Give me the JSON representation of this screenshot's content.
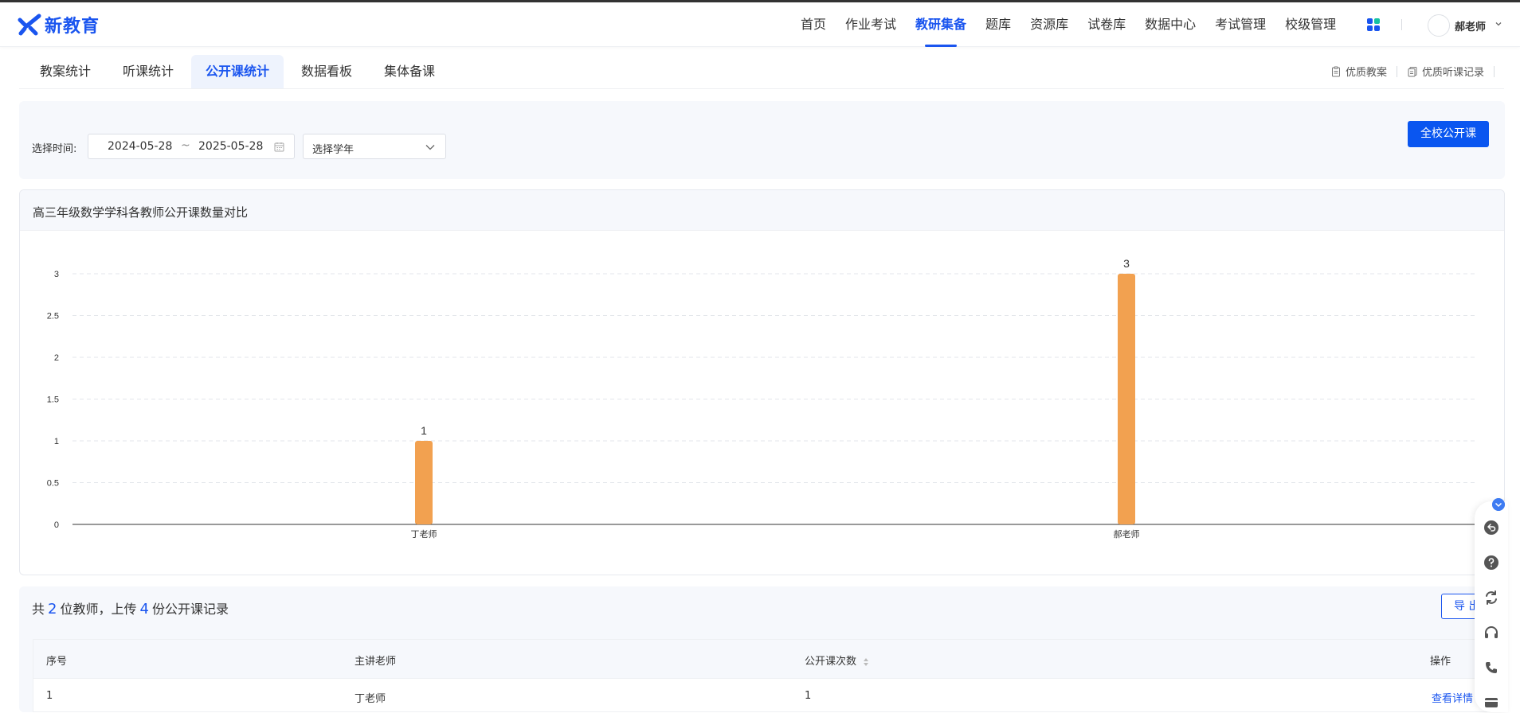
{
  "app": {
    "logo_text": "新教育",
    "brand_color": "#1a55ef"
  },
  "nav": {
    "items": [
      {
        "label": "首页"
      },
      {
        "label": "作业考试"
      },
      {
        "label": "教研集备",
        "active": true
      },
      {
        "label": "题库"
      },
      {
        "label": "资源库"
      },
      {
        "label": "试卷库"
      },
      {
        "label": "数据中心"
      },
      {
        "label": "考试管理"
      },
      {
        "label": "校级管理"
      }
    ],
    "apps_icon": "apps-grid-icon",
    "user": {
      "name": "郝老师"
    }
  },
  "subnav": {
    "tabs": [
      {
        "label": "教案统计"
      },
      {
        "label": "听课统计"
      },
      {
        "label": "公开课统计",
        "active": true
      },
      {
        "label": "数据看板"
      },
      {
        "label": "集体备课"
      }
    ],
    "quick_links": [
      {
        "label": "优质教案",
        "icon": "clipboard-icon"
      },
      {
        "label": "优质听课记录",
        "icon": "notes-icon"
      }
    ]
  },
  "filters": {
    "time_label": "选择时间:",
    "start_date": "2024-05-28",
    "range_sep": "~",
    "end_date": "2025-05-28",
    "year_placeholder": "选择学年",
    "school_button": "全校公开课"
  },
  "chart": {
    "title": "高三年级数学学科各教师公开课数量对比"
  },
  "chart_data": {
    "type": "bar",
    "title": "高三年级数学学科各教师公开课数量对比",
    "categories": [
      "丁老师",
      "郝老师"
    ],
    "values": [
      1,
      3
    ],
    "data_labels": [
      "1",
      "3"
    ],
    "ylim": [
      0,
      3
    ],
    "yticks": [
      "0",
      "0.5",
      "1",
      "1.5",
      "2",
      "2.5",
      "3"
    ],
    "grid": true,
    "bar_color": "#f2a150",
    "xlabel": "",
    "ylabel": ""
  },
  "summary": {
    "prefix": "共",
    "teacher_count": "2",
    "mid": "位教师，上传",
    "record_count": "4",
    "suffix": "份公开课记录",
    "export_label": "导 出"
  },
  "table": {
    "headers": {
      "index": "序号",
      "teacher": "主讲老师",
      "count": "公开课次数",
      "action": "操作"
    },
    "rows": [
      {
        "index": "1",
        "teacher": "丁老师",
        "count": "1",
        "action": "查看详情"
      }
    ]
  },
  "side_toolbar": {
    "tools": [
      "undo-icon",
      "help-icon",
      "refresh-icon",
      "headset-icon",
      "phone-icon",
      "card-icon"
    ]
  }
}
